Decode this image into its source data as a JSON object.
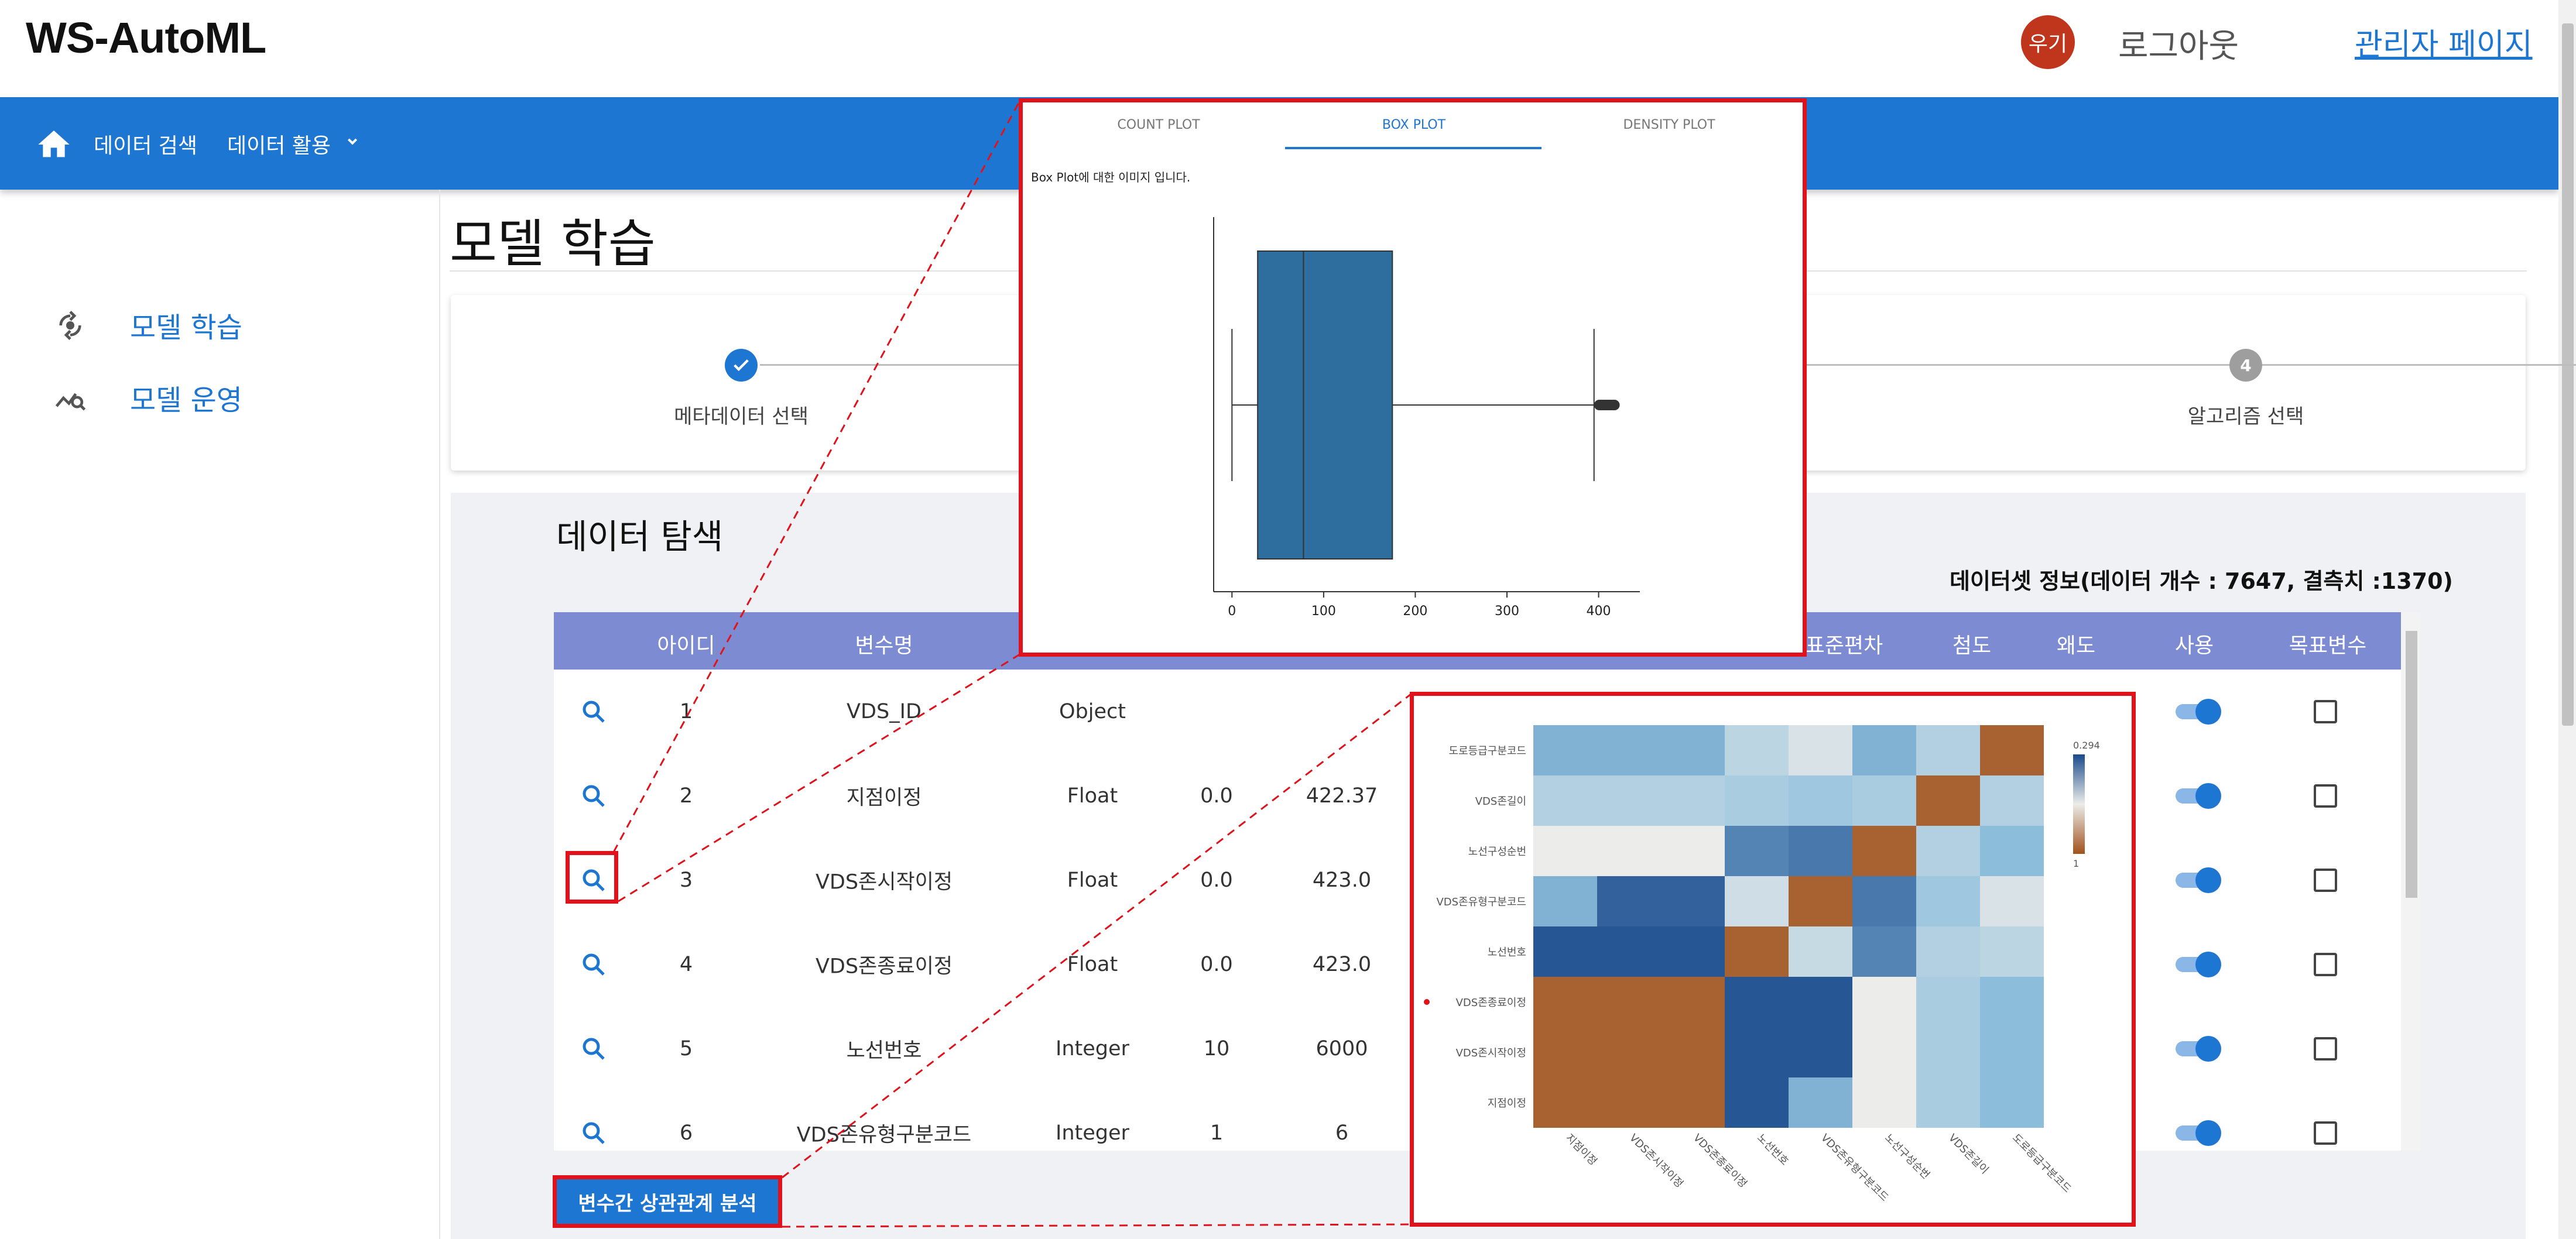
{
  "header": {
    "logo": "WS-AutoML",
    "avatar_text": "우기",
    "logout": "로그아웃",
    "admin_link": "관리자 페이지"
  },
  "nav": {
    "home_icon": "home-icon",
    "items": [
      {
        "label": "데이터 검색"
      },
      {
        "label": "데이터 활용"
      }
    ]
  },
  "sidebar": {
    "items": [
      {
        "label": "모델 학습",
        "icon": "model-train-icon"
      },
      {
        "label": "모델 운영",
        "icon": "model-ops-icon"
      }
    ]
  },
  "main": {
    "title": "모델 학습",
    "steps": [
      {
        "label": "메타데이터 선택",
        "number": "",
        "status": "done"
      },
      {
        "label": "알고리즘 선택",
        "number": "4",
        "status": "pending"
      }
    ],
    "explore_title": "데이터 탐색",
    "dataset_info": "데이터셋 정보(데이터 개수 : 7647, 결측치 :1370)",
    "table": {
      "columns": [
        "아이디",
        "변수명",
        "표준편차",
        "첨도",
        "왜도",
        "사용",
        "목표변수"
      ],
      "rows": [
        {
          "id": "1",
          "name": "VDS_ID",
          "type": "Object",
          "min": "",
          "max": "",
          "use": true,
          "target": false
        },
        {
          "id": "2",
          "name": "지점이정",
          "type": "Float",
          "min": "0.0",
          "max": "422.37",
          "use": true,
          "target": false
        },
        {
          "id": "3",
          "name": "VDS존시작이정",
          "type": "Float",
          "min": "0.0",
          "max": "423.0",
          "use": true,
          "target": false
        },
        {
          "id": "4",
          "name": "VDS존종료이정",
          "type": "Float",
          "min": "0.0",
          "max": "423.0",
          "use": true,
          "target": false
        },
        {
          "id": "5",
          "name": "노선번호",
          "type": "Integer",
          "min": "10",
          "max": "6000",
          "use": true,
          "target": false
        },
        {
          "id": "6",
          "name": "VDS존유형구분코드",
          "type": "Integer",
          "min": "1",
          "max": "6",
          "use": true,
          "target": false
        }
      ]
    },
    "corr_button": "변수간 상관관계 분석"
  },
  "box_popup": {
    "tabs": [
      "COUNT PLOT",
      "BOX PLOT",
      "DENSITY PLOT"
    ],
    "active_tab": "BOX PLOT",
    "caption": "Box Plot에 대한 이미지 입니다."
  },
  "chart_data": [
    {
      "type": "box",
      "title": "",
      "xlabel": "",
      "ylabel": "",
      "xlim": [
        -20,
        445
      ],
      "x_ticks": [
        "0",
        "100",
        "200",
        "300",
        "400"
      ],
      "whisker_low": 0,
      "q1": 28,
      "median": 78,
      "q3": 175,
      "whisker_high": 395,
      "outliers_range": [
        395,
        423
      ],
      "color": "#2e6e9e"
    },
    {
      "type": "heatmap",
      "title": "",
      "y_labels": [
        "도로등급구분코드",
        "VDS존길이",
        "노선구성순번",
        "VDS존유형구분코드",
        "노선번호",
        "VDS존종료이정",
        "VDS존시작이정",
        "지점이정"
      ],
      "x_labels": [
        "지점이정",
        "VDS존시작이정",
        "VDS존종료이정",
        "노선번호",
        "VDS존유형구분코드",
        "노선구성순번",
        "VDS존길이",
        "도로등급구분코드"
      ],
      "colorbar_labels": [
        "0.294",
        "1"
      ],
      "values": [
        [
          0.55,
          0.55,
          0.55,
          0.25,
          0.1,
          0.55,
          0.3,
          -0.9
        ],
        [
          0.3,
          0.3,
          0.3,
          0.35,
          0.4,
          0.35,
          -0.9,
          0.3
        ],
        [
          0.0,
          0.0,
          0.0,
          0.75,
          0.8,
          -0.9,
          0.3,
          0.5
        ],
        [
          0.55,
          0.9,
          0.9,
          0.15,
          -0.9,
          0.8,
          0.4,
          0.1
        ],
        [
          0.95,
          0.95,
          0.95,
          -0.9,
          0.2,
          0.75,
          0.3,
          0.25
        ],
        [
          -0.9,
          -0.9,
          -0.9,
          0.95,
          0.95,
          0.0,
          0.35,
          0.5
        ],
        [
          -0.9,
          -0.9,
          -0.9,
          0.95,
          0.95,
          0.0,
          0.35,
          0.5
        ],
        [
          -0.9,
          -0.9,
          -0.9,
          0.95,
          0.55,
          0.0,
          0.35,
          0.5
        ]
      ]
    }
  ],
  "colors": {
    "brand": "#1e76d3",
    "table_header": "#7d8bd2",
    "highlight": "#e0131c",
    "avatar": "#c0361c"
  }
}
